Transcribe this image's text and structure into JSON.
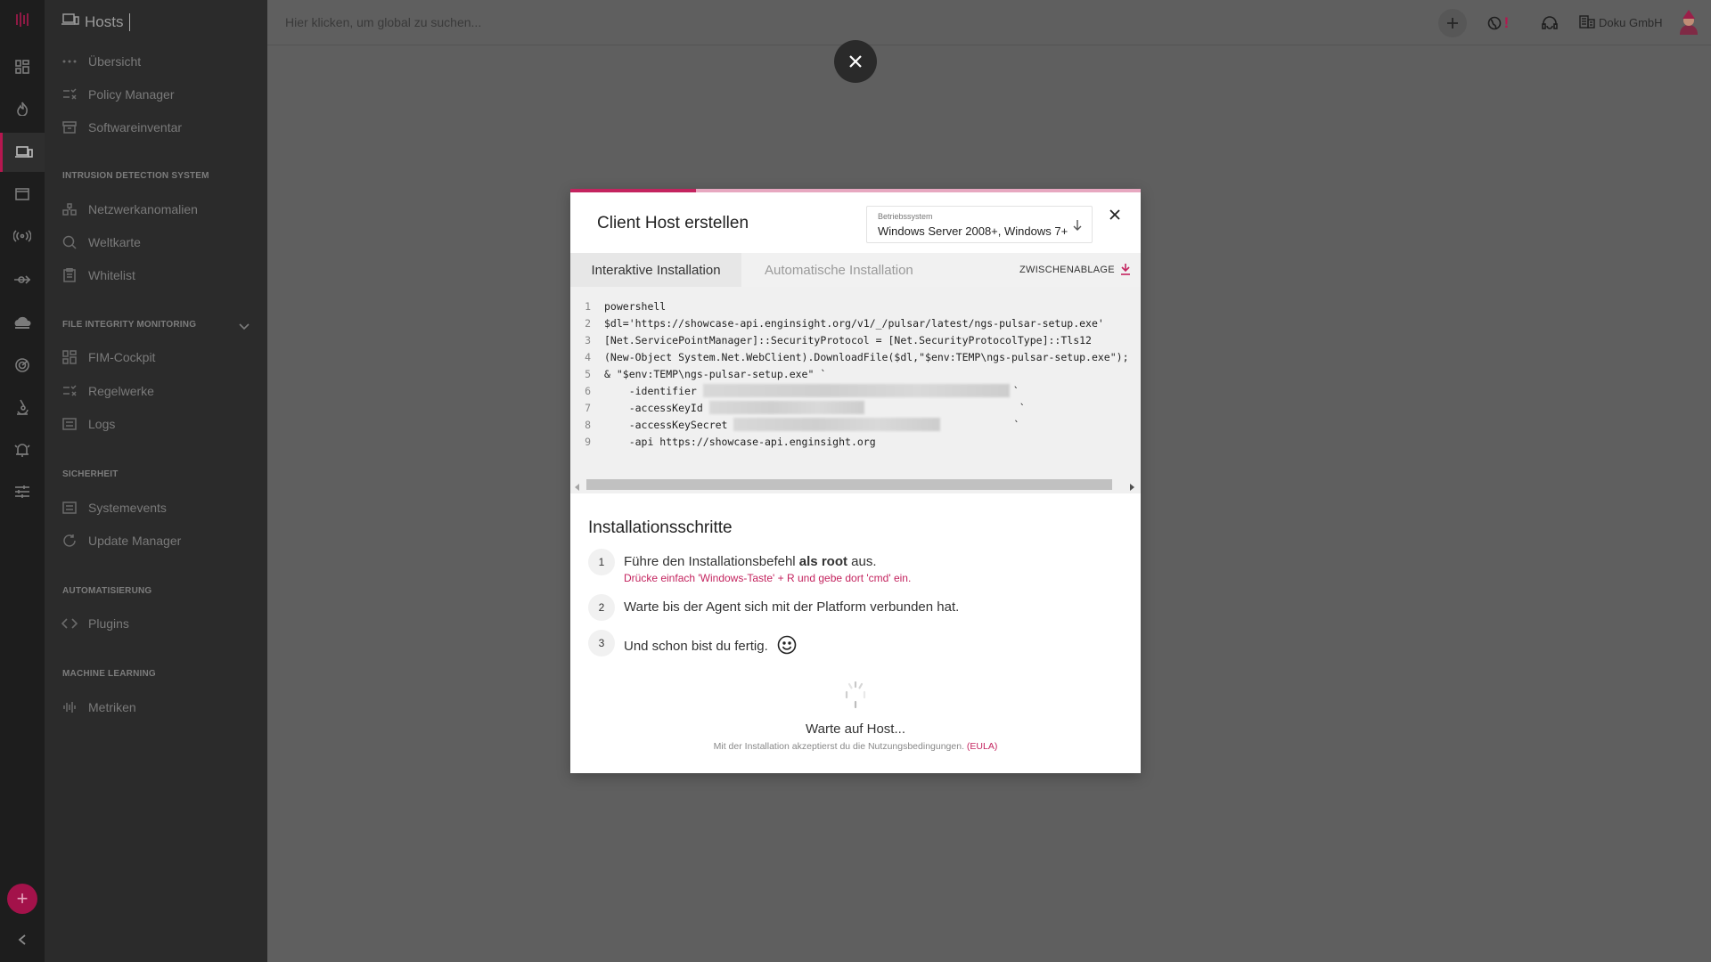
{
  "sidebar": {
    "title": "Hosts",
    "items_top": [
      {
        "label": "Übersicht",
        "icon": "dots-icon"
      },
      {
        "label": "Policy Manager",
        "icon": "checklist-icon"
      },
      {
        "label": "Softwareinventar",
        "icon": "inventory-icon"
      }
    ],
    "sections": [
      {
        "title": "INTRUSION DETECTION SYSTEM",
        "items": [
          {
            "label": "Netzwerkanomalien",
            "icon": "network-icon"
          },
          {
            "label": "Weltkarte",
            "icon": "globe-search-icon"
          },
          {
            "label": "Whitelist",
            "icon": "clipboard-icon"
          }
        ]
      },
      {
        "title": "FILE INTEGRITY MONITORING",
        "items": [
          {
            "label": "FIM-Cockpit",
            "icon": "grid-icon"
          },
          {
            "label": "Regelwerke",
            "icon": "checklist-icon"
          },
          {
            "label": "Logs",
            "icon": "log-icon"
          }
        ]
      },
      {
        "title": "SICHERHEIT",
        "items": [
          {
            "label": "Systemevents",
            "icon": "log-icon"
          },
          {
            "label": "Update Manager",
            "icon": "refresh-icon"
          }
        ]
      },
      {
        "title": "AUTOMATISIERUNG",
        "items": [
          {
            "label": "Plugins",
            "icon": "code-icon"
          }
        ]
      },
      {
        "title": "MACHINE LEARNING",
        "items": [
          {
            "label": "Metriken",
            "icon": "waveform-icon"
          }
        ]
      }
    ]
  },
  "topbar": {
    "search_placeholder": "Hier klicken, um global zu suchen...",
    "org_name": "Doku GmbH",
    "alert_mark": "!"
  },
  "modal": {
    "title": "Client Host erstellen",
    "progress_fraction": 0.22,
    "os_label": "Betriebssystem",
    "os_value": "Windows Server 2008+, Windows 7+",
    "tabs": {
      "active": "Interaktive Installation",
      "inactive": "Automatische Installation",
      "clipboard": "ZWISCHENABLAGE"
    },
    "code_lines": [
      {
        "n": "1",
        "text": "powershell"
      },
      {
        "n": "2",
        "text": "$dl='https://showcase-api.enginsight.org/v1/_/pulsar/latest/ngs-pulsar-setup.exe'"
      },
      {
        "n": "3",
        "text": "[Net.ServicePointManager]::SecurityProtocol = [Net.SecurityProtocolType]::Tls12"
      },
      {
        "n": "4",
        "text": "(New-Object System.Net.WebClient).DownloadFile($dl,\"$env:TEMP\\ngs-pulsar-setup.exe\");"
      },
      {
        "n": "5",
        "text": "& \"$env:TEMP\\ngs-pulsar-setup.exe\" `"
      },
      {
        "n": "6",
        "text": "    -identifier "
      },
      {
        "n": "7",
        "text": "    -accessKeyId "
      },
      {
        "n": "8",
        "text": "    -accessKeySecret "
      },
      {
        "n": "9",
        "text": "    -api https://showcase-api.enginsight.org"
      }
    ],
    "backtick": "`",
    "steps_title": "Installationsschritte",
    "steps": [
      {
        "num": "1",
        "text_a": "Führe den Installationsbefehl ",
        "text_b": "als root",
        "text_c": " aus.",
        "hint": "Drücke einfach 'Windows-Taste' + R und gebe dort 'cmd' ein."
      },
      {
        "num": "2",
        "text": "Warte bis der Agent sich mit der Platform verbunden hat."
      },
      {
        "num": "3",
        "text": "Und schon bist du fertig."
      }
    ],
    "waiting": "Warte auf Host...",
    "eula_text": "Mit der Installation akzeptierst du die Nutzungsbedingungen.",
    "eula_link": "(EULA)"
  },
  "colors": {
    "accent": "#c4245f",
    "rail_bg": "#1d1d1d",
    "sidebar_bg": "#2b2b2b",
    "overlay_bg": "#5f5f5f"
  }
}
